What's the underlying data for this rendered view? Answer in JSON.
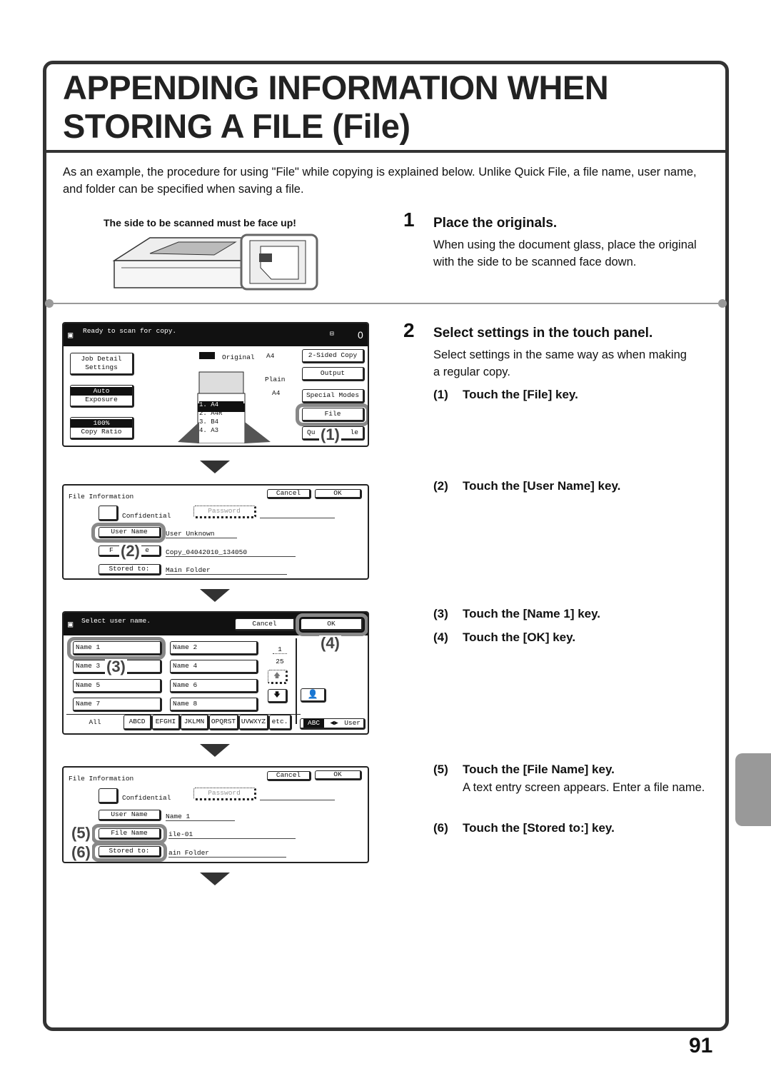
{
  "title_line1": "APPENDING INFORMATION WHEN",
  "title_line2": "STORING A FILE (File)",
  "intro": "As an example, the procedure for using \"File\" while copying is explained below. Unlike Quick File, a file name, user name, and folder can be specified when saving a file.",
  "scan_caption": "The side to be scanned must be face up!",
  "steps": [
    {
      "number": "1",
      "title": "Place the originals.",
      "body": "When using the document glass, place the original with the side to be scanned face down."
    },
    {
      "number": "2",
      "title": "Select settings in the touch panel.",
      "body": "Select settings in the same way as when making a regular copy."
    }
  ],
  "substeps": [
    {
      "number": "(1)",
      "text": "Touch the [File] key."
    },
    {
      "number": "(2)",
      "text": "Touch the [User Name] key."
    },
    {
      "number": "(3)",
      "text": "Touch the [Name 1] key."
    },
    {
      "number": "(4)",
      "text": "Touch the [OK] key."
    },
    {
      "number": "(5)",
      "text": "Touch the [File Name] key.",
      "body": "A text entry screen appears. Enter a file name."
    },
    {
      "number": "(6)",
      "text": "Touch the [Stored to:] key."
    }
  ],
  "panel1": {
    "status": "Ready to scan for copy.",
    "count": "0",
    "job_detail": "Job Detail Settings",
    "exposure_value": "Auto",
    "exposure_label": "Exposure",
    "ratio_value": "100%",
    "ratio_label": "Copy Ratio",
    "original_label": "Original",
    "original_size": "A4",
    "paper_type": "Plain",
    "paper_size": "A4",
    "trays": [
      {
        "n": "1.",
        "size": "A4"
      },
      {
        "n": "2.",
        "size": "A4R"
      },
      {
        "n": "3.",
        "size": "B4"
      },
      {
        "n": "4.",
        "size": "A3"
      }
    ],
    "two_sided": "2-Sided Copy",
    "output": "Output",
    "special_modes": "Special Modes",
    "file": "File",
    "quick_file_a": "Qu",
    "quick_file_b": "le",
    "callout": "(1)"
  },
  "panel2": {
    "title": "File Information",
    "cancel": "Cancel",
    "ok": "OK",
    "confidential": "Confidential",
    "password": "Password",
    "user_name": "User Name",
    "user_value": "User Unknown",
    "file_name_a": "F",
    "file_name_b": "e",
    "file_value": "Copy_04042010_134050",
    "stored_to": "Stored to:",
    "folder_value": "Main Folder",
    "callout": "(2)"
  },
  "panel3": {
    "status": "Select user name.",
    "cancel": "Cancel",
    "ok": "OK",
    "names": [
      "Name 1",
      "Name 2",
      "Name 3",
      "Name 4",
      "Name 5",
      "Name 6",
      "Name 7",
      "Name 8"
    ],
    "page_current": "1",
    "page_total": "25",
    "tabs": [
      "All",
      "ABCD",
      "EFGHI",
      "JKLMN",
      "OPQRST",
      "UVWXYZ",
      "etc."
    ],
    "abc": "ABC",
    "user": "User",
    "callout3": "(3)",
    "callout4": "(4)"
  },
  "panel4": {
    "title": "File Information",
    "cancel": "Cancel",
    "ok": "OK",
    "confidential": "Confidential",
    "password": "Password",
    "user_name": "User Name",
    "user_value": "Name 1",
    "file_name": "File Name",
    "file_value": "ile-01",
    "stored_to": "Stored to:",
    "folder_value": "ain Folder",
    "callout5": "(5)",
    "callout6": "(6)"
  },
  "page_number": "91"
}
